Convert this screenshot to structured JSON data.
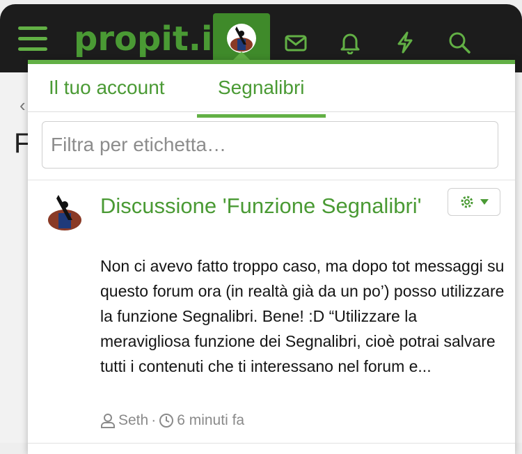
{
  "header": {
    "logo_text": "propit.it",
    "menu_icon": "hamburger-icon",
    "nav_icons": [
      "envelope-icon",
      "bell-icon",
      "lightning-icon",
      "search-icon"
    ],
    "accent": "#62b045",
    "bar_bg": "#1c1c1c"
  },
  "background": {
    "back_glyph": "‹",
    "heading_letter": "F"
  },
  "popup": {
    "tabs": [
      {
        "label": "Il tuo account",
        "active": false
      },
      {
        "label": "Segnalibri",
        "active": true
      }
    ],
    "filter": {
      "placeholder": "Filtra per etichetta…",
      "value": ""
    },
    "bookmark": {
      "title": "Discussione 'Funzione Segnalibri'",
      "snippet": "Non ci avevo fatto troppo caso, ma dopo tot messaggi su questo forum ora (in realtà già da un po’) posso utilizzare la funzione Segnalibri. Bene! :D “Utilizzare la meravigliosa funzione dei Segnalibri, cioè potrai salvare tutti i contenuti che ti interessano nel forum e...",
      "author": "Seth",
      "separator": "·",
      "time": "6 minuti fa"
    }
  }
}
